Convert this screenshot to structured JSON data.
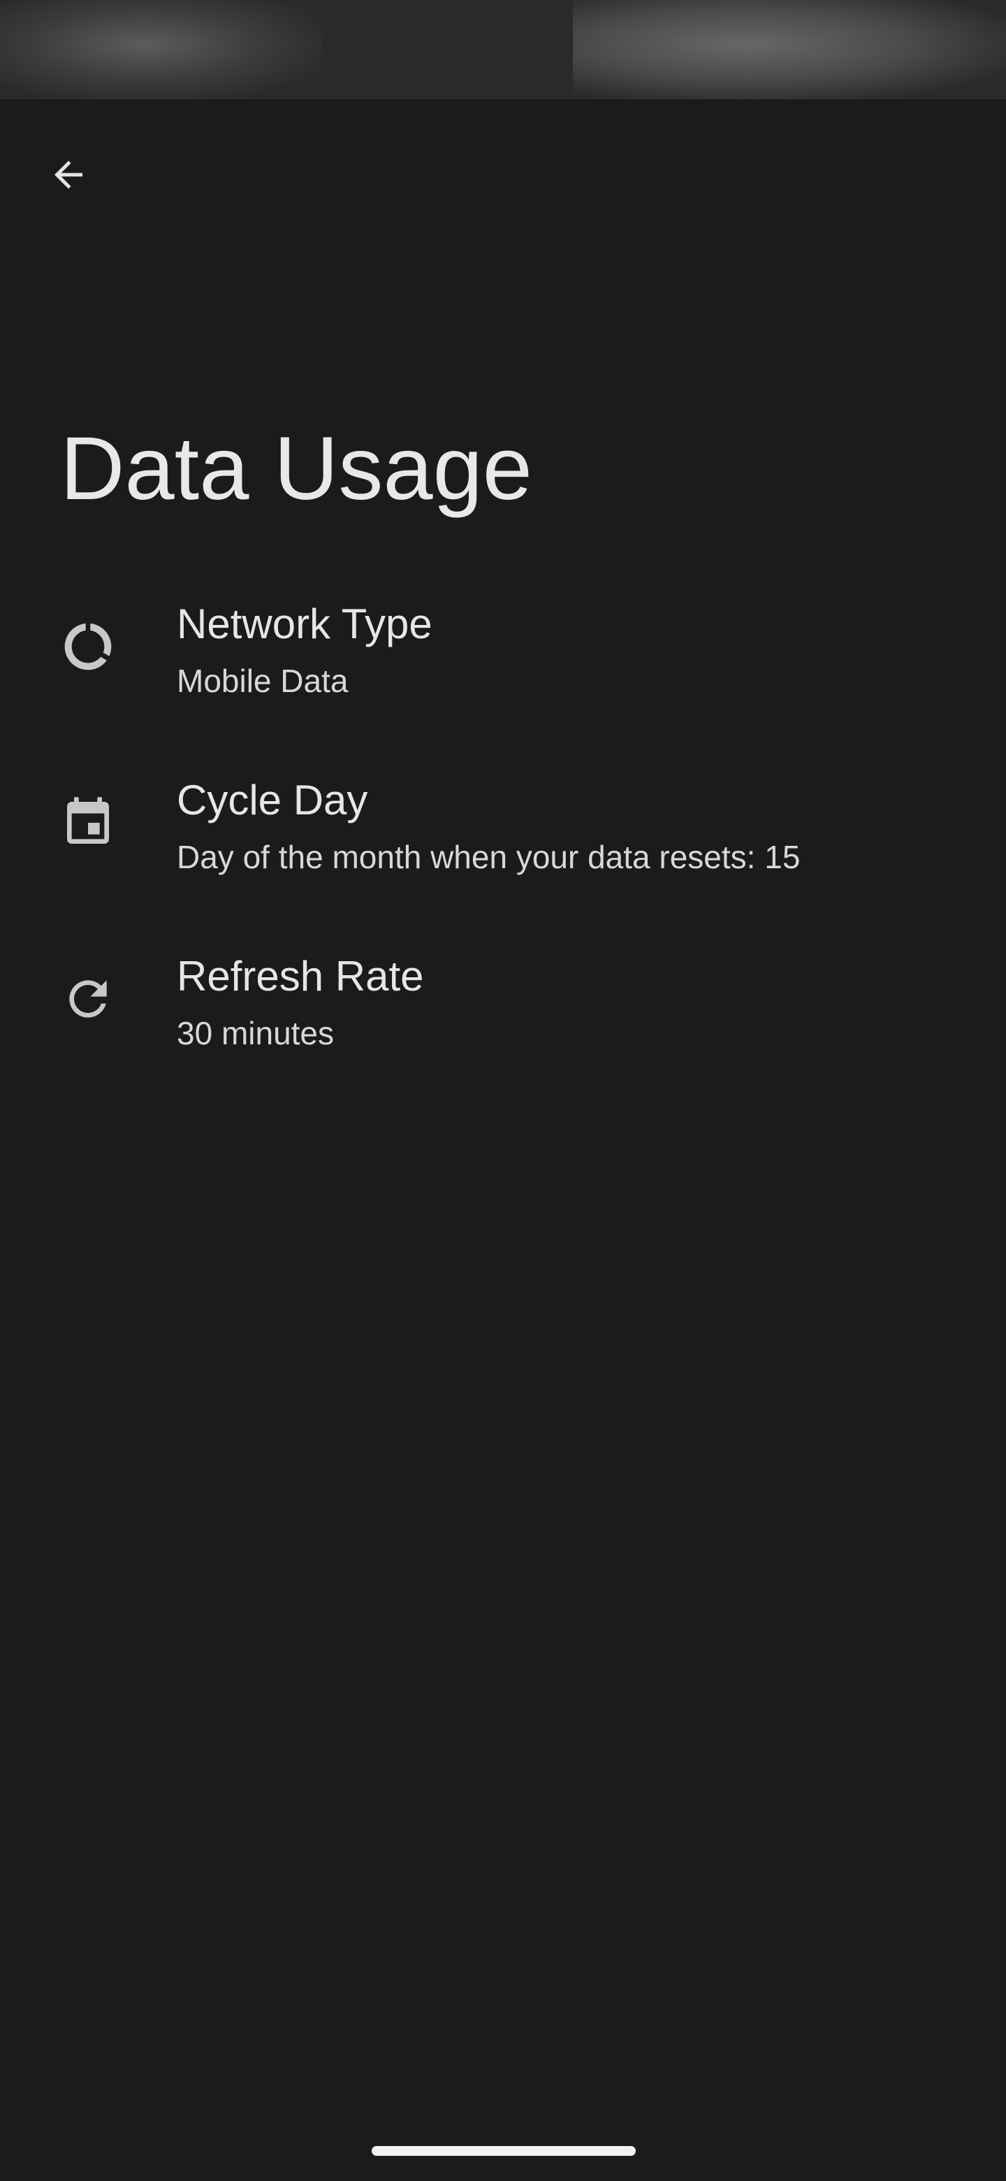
{
  "header": {
    "back_icon": "arrow-back-icon",
    "title": "Data Usage"
  },
  "preferences": [
    {
      "icon": "progress-ring-icon",
      "title": "Network Type",
      "summary": "Mobile Data"
    },
    {
      "icon": "calendar-icon",
      "title": "Cycle Day",
      "summary": "Day of the month when your data resets: 15"
    },
    {
      "icon": "refresh-icon",
      "title": "Refresh Rate",
      "summary": "30 minutes"
    }
  ],
  "colors": {
    "background": "#1b1b1b",
    "text": "#e6e6e6",
    "icon": "#c8c8c8"
  }
}
